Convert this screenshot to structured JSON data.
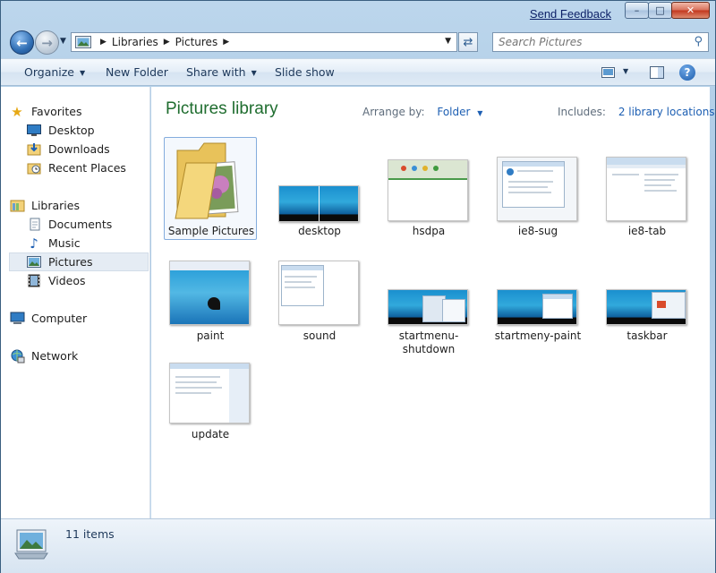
{
  "window": {
    "send_feedback": "Send Feedback",
    "minimize": "–",
    "maximize": "□",
    "close": "✕"
  },
  "address": {
    "crumbs": [
      "Libraries",
      "Pictures"
    ],
    "search_placeholder": "Search Pictures"
  },
  "toolbar": {
    "organize": "Organize",
    "new_folder": "New Folder",
    "share_with": "Share with",
    "slide_show": "Slide show",
    "help": "?"
  },
  "nav": {
    "favorites": "Favorites",
    "desktop": "Desktop",
    "downloads": "Downloads",
    "recent_places": "Recent Places",
    "libraries": "Libraries",
    "documents": "Documents",
    "music": "Music",
    "pictures": "Pictures",
    "videos": "Videos",
    "computer": "Computer",
    "network": "Network",
    "selected": "Pictures"
  },
  "content": {
    "title": "Pictures library",
    "arrange_label": "Arrange by:",
    "arrange_value": "Folder",
    "includes_label": "Includes:",
    "includes_link": "2 library locations",
    "items": [
      {
        "name": "Sample Pictures",
        "kind": "folder"
      },
      {
        "name": "desktop",
        "kind": "image"
      },
      {
        "name": "hsdpa",
        "kind": "image"
      },
      {
        "name": "ie8-sug",
        "kind": "image"
      },
      {
        "name": "ie8-tab",
        "kind": "image"
      },
      {
        "name": "paint",
        "kind": "image"
      },
      {
        "name": "sound",
        "kind": "image"
      },
      {
        "name": "startmenu-shutdown",
        "kind": "image"
      },
      {
        "name": "startmeny-paint",
        "kind": "image"
      },
      {
        "name": "taskbar",
        "kind": "image"
      },
      {
        "name": "update",
        "kind": "image"
      }
    ]
  },
  "status": {
    "count": "11 items"
  },
  "colors": {
    "title_green": "#1f6d2f",
    "link_blue": "#1d5fb3",
    "selection": "#e5ecf4"
  }
}
